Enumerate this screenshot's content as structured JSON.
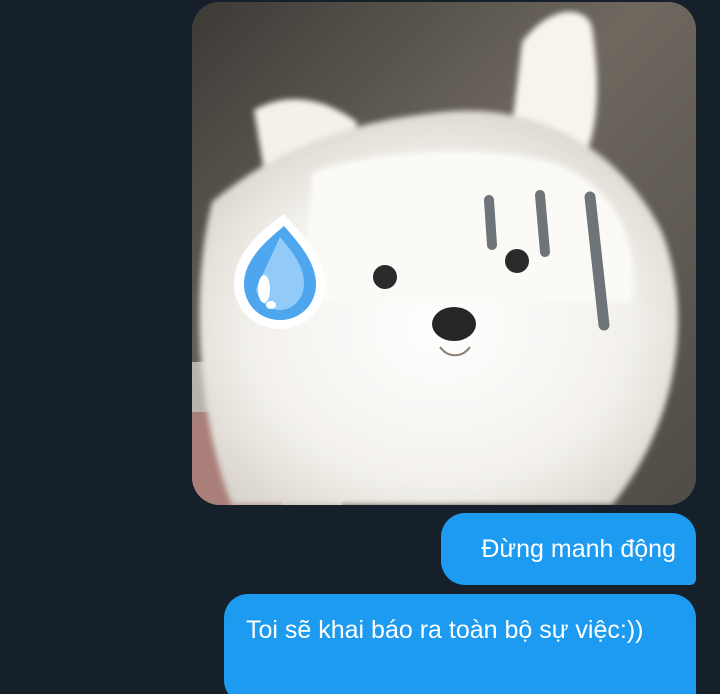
{
  "conversation": {
    "messages": [
      {
        "type": "image",
        "image": "white-puppy-sweat-drop-sticker"
      },
      {
        "type": "text",
        "text": "Đừng manh động"
      },
      {
        "type": "text",
        "text": "Toi sẽ khai báo ra toàn bộ sự việc:))"
      }
    ]
  },
  "colors": {
    "background": "#15202b",
    "bubble": "#1d9bf0",
    "bubble_text": "#ffffff",
    "sweat_drop": "#4ea6ef"
  }
}
